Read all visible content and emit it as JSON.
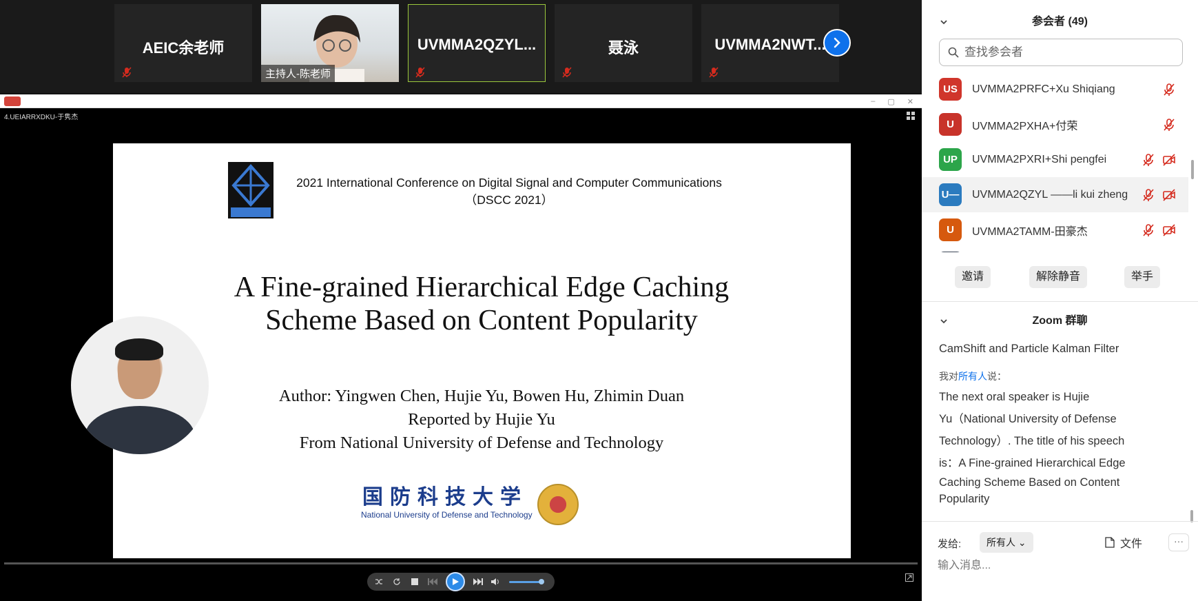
{
  "strip": {
    "tiles": [
      {
        "name": "AEIC余老师",
        "muted": true
      },
      {
        "label": "主持人-陈老师"
      },
      {
        "name": "UVMMA2QZYL...",
        "muted": true
      },
      {
        "name": "聂泳",
        "muted": true
      },
      {
        "name": "UVMMA2NWT...",
        "muted": true
      }
    ]
  },
  "share": {
    "window_title": "4.UEIARRXDKU-于隽杰"
  },
  "slide": {
    "conf_line1": "2021 International Conference on Digital Signal and Computer Communications",
    "conf_line2": "（DSCC 2021）",
    "title_line1": "A Fine-grained Hierarchical Edge Caching",
    "title_line2": "Scheme Based on Content Popularity",
    "authors": "Author: Yingwen Chen, Hujie Yu, Bowen Hu, Zhimin Duan",
    "reported": "Reported by  Hujie Yu",
    "from": "From National University of Defense and Technology",
    "univ_cn": "国防科技大学",
    "univ_en": "National University of Defense and Technology"
  },
  "panel": {
    "participants_title": "参会者 (49)",
    "search_placeholder": "查找参会者",
    "participants": [
      {
        "initials": "US",
        "name": "UVMMA2PRFC+Xu Shiqiang",
        "color": "#d0352b"
      },
      {
        "initials": "U",
        "name": "UVMMA2PXHA+付荣",
        "color": "#c8332a"
      },
      {
        "initials": "UP",
        "name": "UVMMA2PXRI+Shi pengfei",
        "color": "#2ca54a"
      },
      {
        "initials": "U—",
        "name": "UVMMA2QZYL ——li kui zheng",
        "color": "#2b7bbf"
      },
      {
        "initials": "U",
        "name": "UVMMA2TAMM-田豪杰",
        "color": "#d6590e"
      }
    ],
    "buttons": {
      "invite": "邀请",
      "unmute": "解除静音",
      "raise_hand": "举手"
    },
    "chat_title": "Zoom 群聊",
    "chat_prev": "CamShift and Particle Kalman Filter",
    "chat_meta_prefix": "我对",
    "chat_meta_target": "所有人",
    "chat_meta_suffix": "说：",
    "chat_msg_lines": [
      "The next oral speaker is Hujie",
      "Yu（National University of Defense",
      "Technology）. The title of his speech",
      "is：A Fine-grained Hierarchical Edge",
      "Caching Scheme Based on Content",
      "Popularity"
    ],
    "send_label": "发给:",
    "send_to": "所有人",
    "file_label": "文件",
    "more_label": "···",
    "input_placeholder": "输入消息..."
  },
  "colors": {
    "accent": "#0e71eb",
    "mute_red": "#d52b1e",
    "active_border": "#9bc83c"
  }
}
